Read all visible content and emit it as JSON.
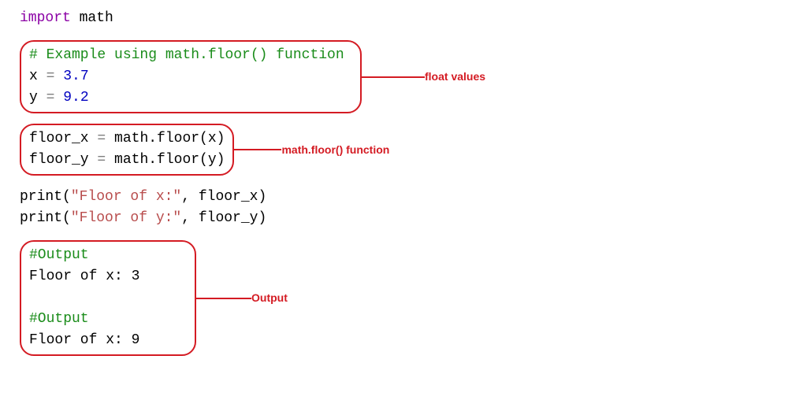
{
  "import_line": {
    "kw": "import",
    "mod": " math"
  },
  "block1": {
    "comment": "# Example using math.floor() function",
    "l1a": "x ",
    "l1op": "=",
    "l1b": " ",
    "l1num": "3.7",
    "l2a": "y ",
    "l2op": "=",
    "l2b": " ",
    "l2num": "9.2",
    "label": "float values"
  },
  "block2": {
    "l1a": "floor_x ",
    "l1op": "=",
    "l1b": " math.floor(x)",
    "l2a": "floor_y ",
    "l2op": "=",
    "l2b": " math.floor(y)",
    "label": "math.floor() function"
  },
  "prints": {
    "l1a": "print(",
    "l1s": "\"Floor of x:\"",
    "l1b": ", floor_x)",
    "l2a": "print(",
    "l2s": "\"Floor of y:\"",
    "l2b": ", floor_y)"
  },
  "block3": {
    "c1": "#Output",
    "r1": "Floor of x: 3",
    "c2": "#Output",
    "r2": "Floor of x: 9",
    "label": "Output"
  }
}
